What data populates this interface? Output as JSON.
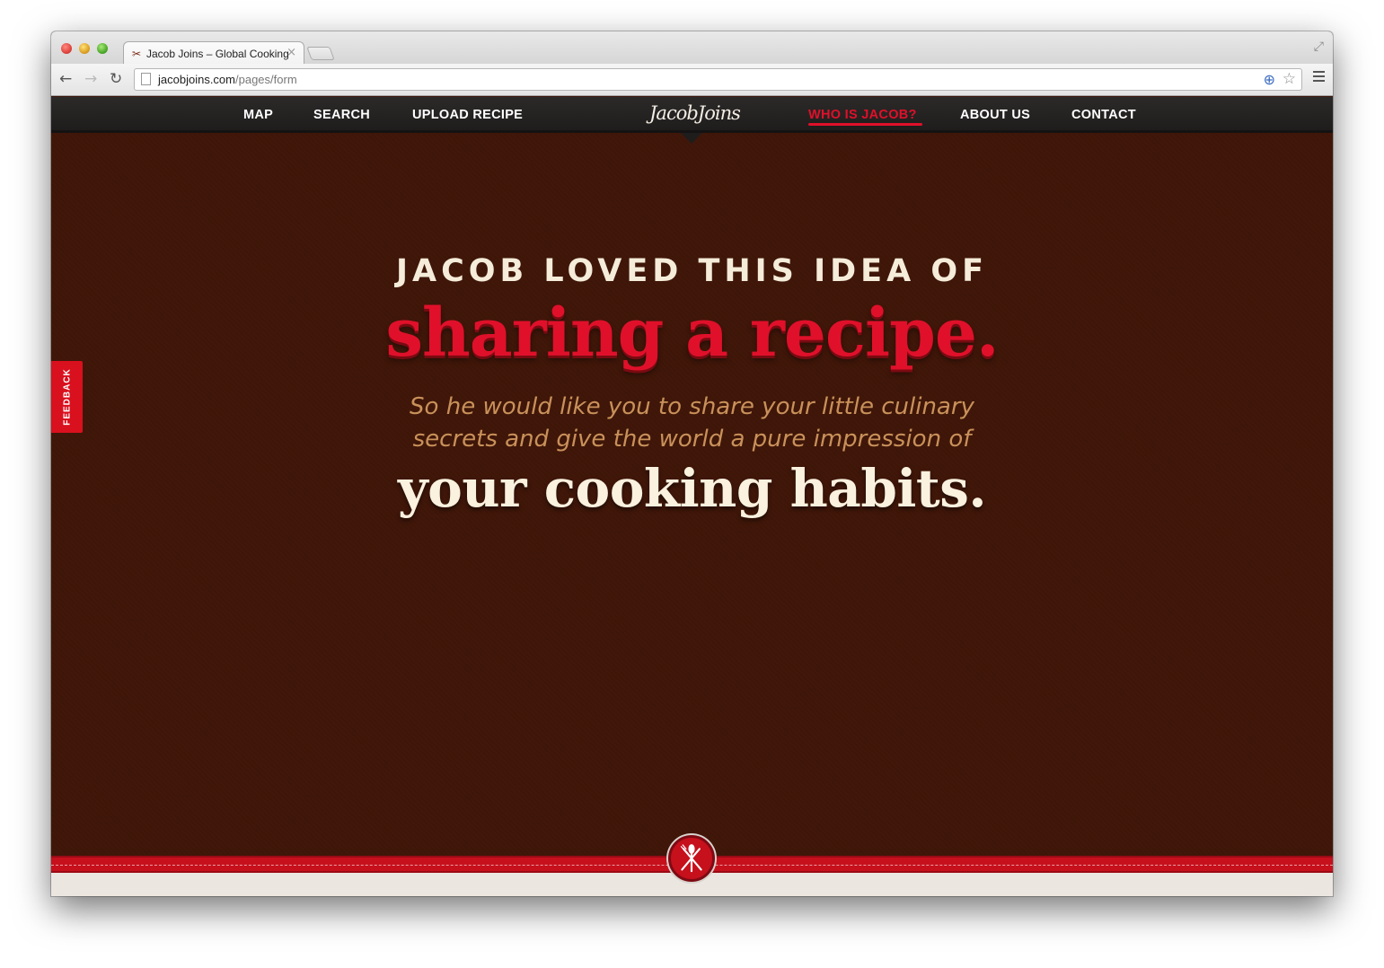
{
  "browser": {
    "tab_title": "Jacob Joins – Global Cooking",
    "tab_favicon_glyph": "✂",
    "tab_close_glyph": "×",
    "url_host": "jacobjoins.com",
    "url_path": "/pages/form",
    "back_glyph": "←",
    "forward_glyph": "→",
    "reload_glyph": "↻",
    "resize_glyph": "⤢",
    "extension_glyph": "⊕",
    "bookmark_glyph": "☆"
  },
  "nav": {
    "items": [
      {
        "label": "MAP"
      },
      {
        "label": "SEARCH"
      },
      {
        "label": "UPLOAD RECIPE"
      },
      {
        "label": "WHO IS JACOB?"
      },
      {
        "label": "ABOUT US"
      },
      {
        "label": "CONTACT"
      }
    ],
    "logo_text": "JacobJoins",
    "active_item": "WHO IS JACOB?"
  },
  "feedback": {
    "label": "FEEDBACK"
  },
  "hero": {
    "line1": "JACOB LOVED THIS IDEA OF",
    "line2": "sharing a recipe.",
    "subtitle_lines": [
      "So he would like you to share your little culinary",
      "secrets and give the world a pure impression of"
    ],
    "line3": "your cooking habits."
  },
  "colors": {
    "accent": "#e0102a",
    "background": "#411709",
    "nav_bg": "#242221",
    "subtitle": "#c9915a",
    "cream": "#faf1df"
  },
  "icons": {
    "emblem": "fork-spoon-knife-icon"
  }
}
